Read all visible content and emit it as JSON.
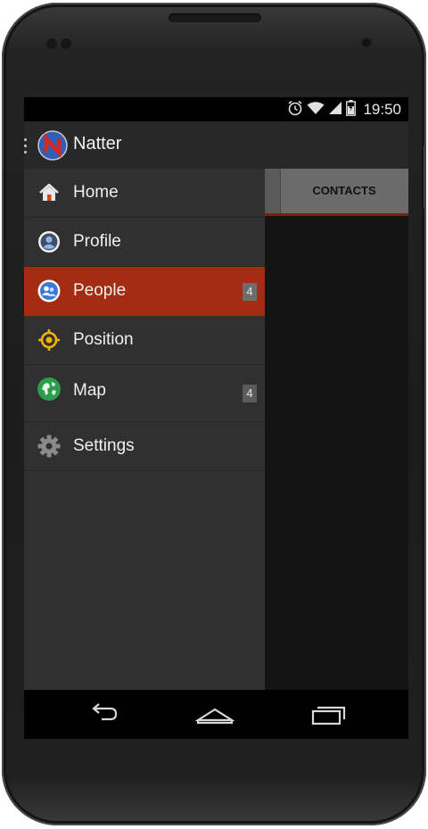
{
  "status_bar": {
    "time": "19:50",
    "icons": [
      "alarm-icon",
      "wifi-icon",
      "signal-icon",
      "battery-icon"
    ]
  },
  "action_bar": {
    "title": "Natter",
    "logo_icon": "natter-logo-icon"
  },
  "content": {
    "tab_label": "CONTACTS"
  },
  "drawer": {
    "items": [
      {
        "label": "Home",
        "icon": "home-icon",
        "badge": null,
        "active": false
      },
      {
        "label": "Profile",
        "icon": "profile-icon",
        "badge": null,
        "active": false
      },
      {
        "label": "People",
        "icon": "people-icon",
        "badge": "4",
        "active": true
      },
      {
        "label": "Position",
        "icon": "position-icon",
        "badge": null,
        "active": false
      },
      {
        "label": "Map",
        "icon": "map-icon",
        "badge": "4",
        "active": false
      },
      {
        "label": "Settings",
        "icon": "settings-icon",
        "badge": null,
        "active": false
      }
    ]
  },
  "system_nav": {
    "buttons": [
      "back-icon",
      "home-nav-icon",
      "recents-icon"
    ]
  },
  "colors": {
    "accent": "#a32c13",
    "drawer_bg": "#303030",
    "action_bar_bg": "#282828",
    "tab_bg": "#6b6b6b"
  }
}
